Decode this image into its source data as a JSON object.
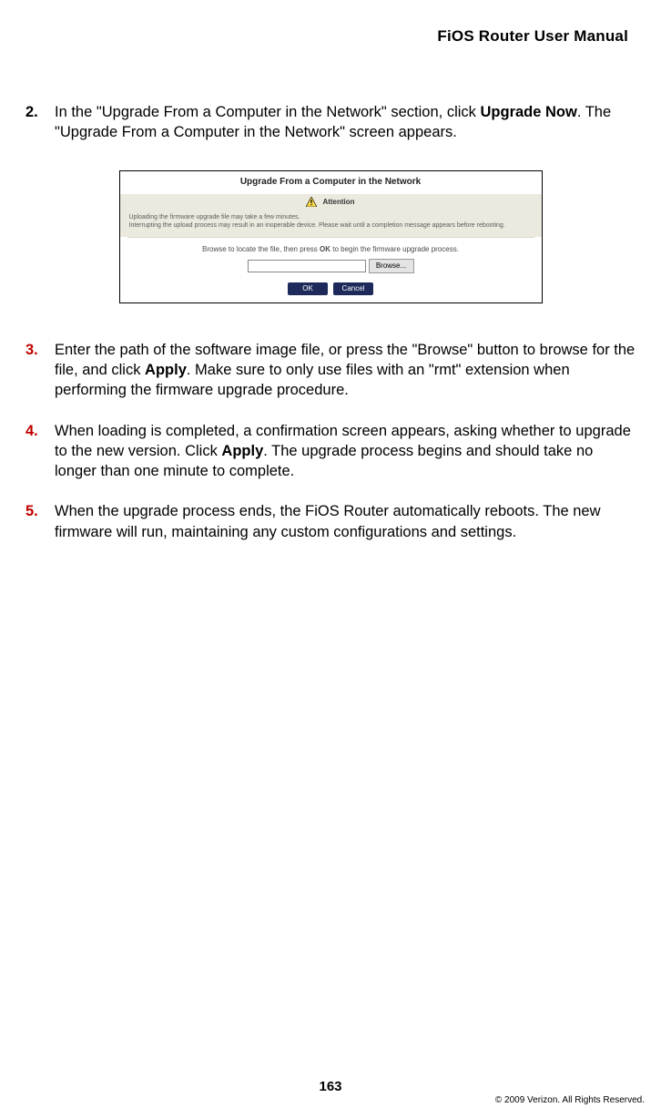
{
  "header": {
    "title": "FiOS Router User Manual"
  },
  "steps": [
    {
      "num": "2.",
      "red": false,
      "text_pre": "In the \"Upgrade From a Computer in the Network\" section, click ",
      "bold1": "Upgrade Now",
      "text_post": ". The \"Upgrade From a Computer in the Network\" screen appears."
    },
    {
      "num": "3.",
      "red": true,
      "text_pre": "Enter the path of the software image file, or press the \"Browse\" button to browse for the file, and click ",
      "bold1": "Apply",
      "text_post": ". Make sure to only use files with an \"rmt\" extension when performing the firmware upgrade procedure."
    },
    {
      "num": "4.",
      "red": true,
      "text_pre": "When loading is completed, a confirmation screen appears, asking whether to upgrade to the new version. Click ",
      "bold1": "Apply",
      "text_post": ". The upgrade process begins and should take no longer than one minute to complete."
    },
    {
      "num": "5.",
      "red": true,
      "text_pre": "When the upgrade process ends, the FiOS Router automatically reboots. The new firmware will run, maintaining any custom configurations and settings.",
      "bold1": "",
      "text_post": ""
    }
  ],
  "panel": {
    "title": "Upgrade From a Computer in the Network",
    "attention_label": "Attention",
    "msg_line1": "Uploading the firmware upgrade file may take a few minutes.",
    "msg_line2": "Interrupting the upload process may result in an inoperable device. Please wait until a completion message appears before rebooting.",
    "instruction_pre": "Browse to locate the file, then press ",
    "instruction_bold": "OK",
    "instruction_post": " to begin the firmware upgrade process.",
    "file_value": "",
    "browse_label": "Browse...",
    "ok_label": "OK",
    "cancel_label": "Cancel"
  },
  "footer": {
    "page_number": "163",
    "copyright": "© 2009 Verizon. All Rights Reserved."
  }
}
